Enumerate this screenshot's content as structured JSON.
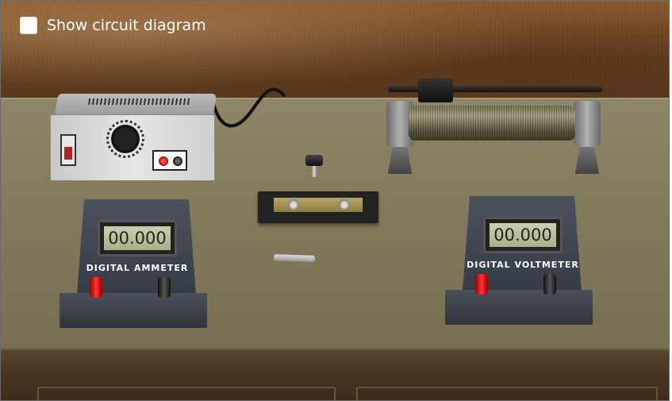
{
  "controls": {
    "show_circuit_diagram_label": "Show circuit diagram",
    "show_circuit_diagram_checked": false
  },
  "ammeter": {
    "reading": "00.000",
    "title": "DIGITAL AMMETER"
  },
  "voltmeter": {
    "reading": "00.000",
    "title": "DIGITAL VOLTMETER"
  },
  "colors": {
    "wall": "#6b4424",
    "table": "#847a5c",
    "meter_body": "#3f4650",
    "lcd": "#b7bf98",
    "terminal_red": "#e02020",
    "terminal_black": "#111111"
  },
  "icons": {
    "checkbox": "checkbox-unchecked-icon"
  }
}
